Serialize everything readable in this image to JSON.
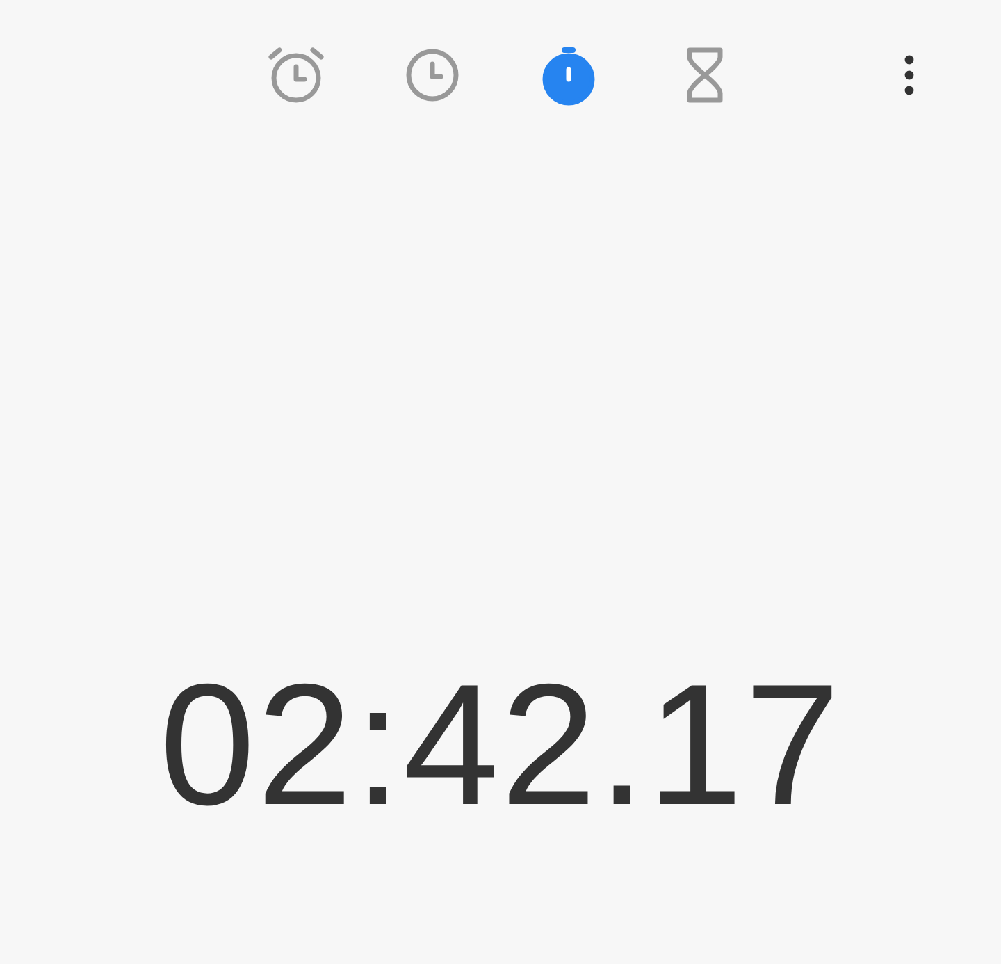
{
  "tabs": [
    {
      "kind": "alarm",
      "selected": false
    },
    {
      "kind": "clock",
      "selected": false
    },
    {
      "kind": "stopwatch",
      "selected": true
    },
    {
      "kind": "timer",
      "selected": false
    }
  ],
  "elapsed_time": "02:42.17"
}
